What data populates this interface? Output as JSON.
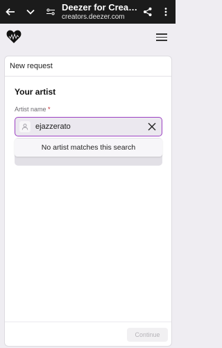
{
  "browser": {
    "title": "Deezer for Creat...",
    "url": "creators.deezer.com",
    "icons": [
      "back-arrow-icon",
      "chevron-down-icon",
      "site-settings-icon",
      "share-icon",
      "more-vert-icon"
    ]
  },
  "header": {
    "logo_icon": "deezer-heart-logo",
    "menu_icon": "hamburger-menu-icon"
  },
  "card": {
    "header_label": "New request",
    "section_title": "Your artist",
    "field_label": "Artist name",
    "required_marker": "*",
    "input_value": "ejazzerato",
    "dropdown_message": "No artist matches this search",
    "continue_label": "Continue"
  },
  "colors": {
    "accent_border": "#9b3fc2",
    "required": "#c3272b",
    "browser_bar": "#1b1b1b"
  }
}
